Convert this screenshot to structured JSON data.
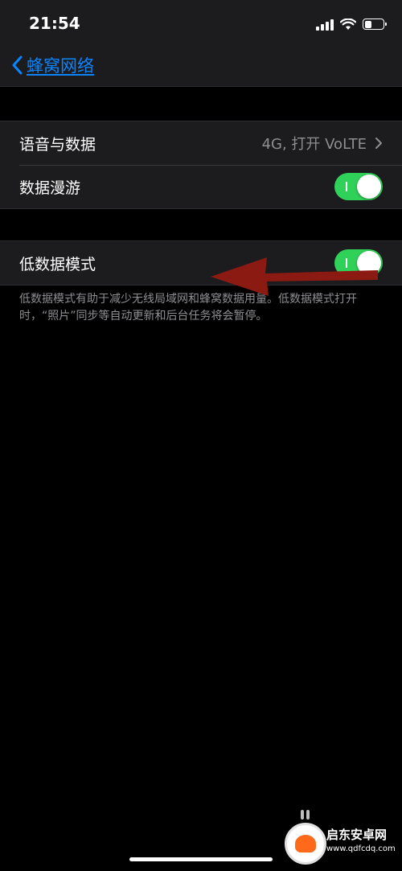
{
  "status_bar": {
    "time": "21:54",
    "icons": [
      "cellular-signal-icon",
      "wifi-icon",
      "battery-icon"
    ]
  },
  "nav": {
    "back_label": "蜂窝网络",
    "accent_color": "#0a84ff"
  },
  "groups": [
    {
      "rows": [
        {
          "label": "语音与数据",
          "value": "4G, 打开 VoLTE",
          "type": "disclosure"
        },
        {
          "label": "数据漫游",
          "type": "toggle",
          "on": true
        }
      ]
    },
    {
      "rows": [
        {
          "label": "低数据模式",
          "type": "toggle",
          "on": true
        }
      ],
      "footer": "低数据模式有助于减少无线局域网和蜂窝数据用量。低数据模式打开时，“照片”同步等自动更新和后台任务将会暂停。"
    }
  ],
  "toggle_on_color": "#30d158",
  "annotation": {
    "type": "red-arrow",
    "color": "#8b1a12",
    "points_to": "低数据模式"
  },
  "watermark": {
    "text": "启东安卓网",
    "url": "www.qdfcdq.com"
  }
}
